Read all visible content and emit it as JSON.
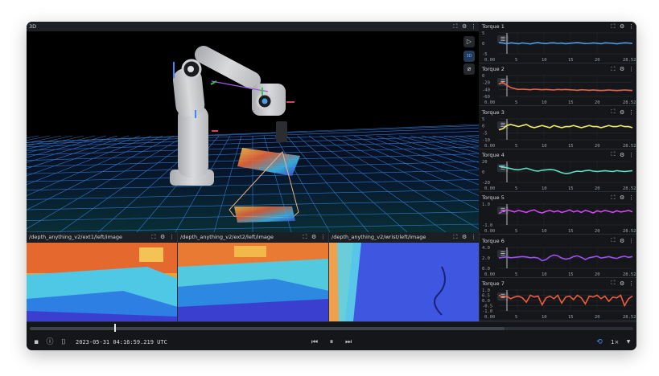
{
  "view3d": {
    "title": "3D",
    "tools": [
      "play-icon",
      "ruler-3d-icon",
      "measure-icon"
    ],
    "tool_glyphs": [
      "▷",
      "3D",
      "⌀"
    ]
  },
  "panel_controls": {
    "maximize": "⛶",
    "settings": "⚙",
    "menu": "⋮"
  },
  "image_panels": [
    {
      "title": "/depth_anything_v2/ext1/left/image"
    },
    {
      "title": "/depth_anything_v2/ext2/left/image"
    },
    {
      "title": "/depth_anything_v2/wrist/left/image"
    }
  ],
  "torque_panels": [
    {
      "title": "Torque 1",
      "yticks": [
        "5",
        "0",
        "-5"
      ],
      "color": "#4f9be8",
      "range": [
        -7,
        7
      ],
      "values": [
        0.5,
        0.2,
        -0.3,
        0.4,
        0.1,
        -0.2,
        0.3,
        0.0,
        -0.4,
        0.2,
        0.5,
        0.1,
        -0.1,
        0.3,
        0.4,
        0.0,
        0.2,
        -0.2,
        0.1,
        0.3,
        0.5,
        0.2,
        -0.1,
        0.0,
        0.3,
        0.1,
        -0.2,
        0.4,
        0.2,
        0.1,
        -0.3,
        0.1,
        0.4,
        0.2,
        0.0
      ]
    },
    {
      "title": "Torque 2",
      "yticks": [
        "0",
        "-20",
        "-40",
        "-60"
      ],
      "color": "#e8624a",
      "range": [
        -70,
        5
      ],
      "values": [
        -25,
        -20,
        -30,
        -38,
        -42,
        -45,
        -44,
        -45,
        -46,
        -44,
        -45,
        -46,
        -45,
        -46,
        -47,
        -45,
        -46,
        -45,
        -46,
        -47,
        -48,
        -46,
        -47,
        -48,
        -47,
        -48,
        -49,
        -48,
        -47,
        -48,
        -49,
        -48,
        -47,
        -48,
        -49
      ]
    },
    {
      "title": "Torque 3",
      "yticks": [
        "5",
        "0",
        "-5",
        "-10"
      ],
      "color": "#f1e86a",
      "range": [
        -12,
        7
      ],
      "values": [
        -3,
        -2,
        1,
        2,
        1,
        0,
        1,
        2,
        0,
        -1,
        0,
        1,
        0,
        -1,
        1,
        0,
        -1,
        0,
        0,
        1,
        0,
        -1,
        0,
        1,
        0,
        0,
        -1,
        0,
        1,
        0,
        0,
        1,
        0,
        0,
        -1
      ]
    },
    {
      "title": "Torque 4",
      "yticks": [
        "20",
        "0",
        "-20"
      ],
      "color": "#5fe0c4",
      "range": [
        -25,
        25
      ],
      "values": [
        14,
        12,
        10,
        8,
        6,
        5,
        7,
        9,
        6,
        3,
        2,
        4,
        5,
        6,
        5,
        2,
        -2,
        -4,
        -3,
        0,
        2,
        1,
        3,
        4,
        2,
        1,
        2,
        3,
        2,
        1,
        3,
        2,
        1,
        2,
        3
      ]
    },
    {
      "title": "Torque 5",
      "yticks": [
        "1.0",
        "-1.0"
      ],
      "color": "#d246f0",
      "range": [
        -2,
        2
      ],
      "values": [
        0.2,
        0.6,
        0.9,
        0.7,
        0.5,
        0.8,
        0.6,
        0.4,
        0.7,
        0.9,
        0.5,
        0.3,
        0.6,
        0.8,
        0.5,
        0.7,
        0.4,
        0.6,
        0.9,
        0.5,
        0.7,
        0.4,
        0.8,
        0.6,
        0.3,
        0.7,
        0.5,
        0.8,
        0.6,
        0.4,
        0.7,
        0.5,
        0.6,
        0.8,
        0.5
      ]
    },
    {
      "title": "Torque 6",
      "yticks": [
        "4.0",
        "2.0",
        "0.0"
      ],
      "color": "#9c4ff0",
      "range": [
        -0.5,
        5
      ],
      "values": [
        2.2,
        2.4,
        2.5,
        2.3,
        2.4,
        2.5,
        2.6,
        2.5,
        2.3,
        2.4,
        2.2,
        1.5,
        1.8,
        2.6,
        3.0,
        2.8,
        2.2,
        1.9,
        2.1,
        2.6,
        2.8,
        2.4,
        1.8,
        2.3,
        2.5,
        2.7,
        2.2,
        2.4,
        2.6,
        2.3,
        2.1,
        2.5,
        2.7,
        2.4,
        2.6
      ]
    },
    {
      "title": "Torque 7",
      "yticks": [
        "1.0",
        "0.5",
        "0.0",
        "-0.5",
        "-1.0"
      ],
      "color": "#ee5a3e",
      "range": [
        -1.2,
        1.2
      ],
      "values": [
        0.6,
        0.4,
        0.5,
        0.2,
        0.4,
        0.5,
        0.3,
        -0.2,
        0.6,
        0.4,
        0.5,
        -0.5,
        0.3,
        0.5,
        0.2,
        0.6,
        -0.3,
        0.4,
        0.5,
        0.1,
        0.6,
        0.3,
        -0.4,
        0.5,
        0.4,
        0.6,
        0.2,
        0.5,
        -0.1,
        0.4,
        0.3,
        0.6,
        -0.6,
        0.2,
        0.5
      ]
    }
  ],
  "x_ticks": [
    "0.00",
    "5",
    "10",
    "15",
    "20",
    "28.52"
  ],
  "timeline": {
    "timestamp": "2023-05-31 04:16:59.219 UTC",
    "speed": "1×",
    "progress": 0.14
  }
}
